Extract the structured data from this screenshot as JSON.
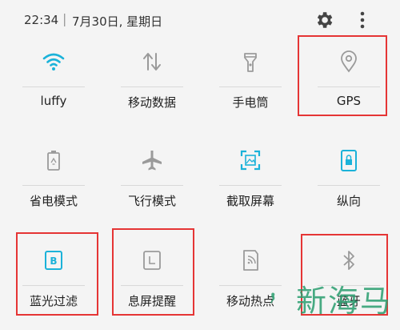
{
  "status": {
    "time": "22:34",
    "separator": "|",
    "date": "7月30日, 星期日"
  },
  "tiles": [
    {
      "label": "luffy",
      "icon": "wifi-icon",
      "active": true
    },
    {
      "label": "移动数据",
      "icon": "mobile-data-icon",
      "active": false
    },
    {
      "label": "手电筒",
      "icon": "flashlight-icon",
      "active": false
    },
    {
      "label": "GPS",
      "icon": "location-icon",
      "active": false
    },
    {
      "label": "省电模式",
      "icon": "power-saving-icon",
      "active": false
    },
    {
      "label": "飞行模式",
      "icon": "airplane-icon",
      "active": false
    },
    {
      "label": "截取屏幕",
      "icon": "screenshot-icon",
      "active": true
    },
    {
      "label": "纵向",
      "icon": "portrait-lock-icon",
      "active": true
    },
    {
      "label": "蓝光过滤",
      "icon": "blue-light-filter-icon",
      "active": true
    },
    {
      "label": "息屏提醒",
      "icon": "always-on-display-icon",
      "active": false
    },
    {
      "label": "移动热点",
      "icon": "hotspot-icon",
      "active": false
    },
    {
      "label": "蓝牙",
      "icon": "bluetooth-icon",
      "active": false
    }
  ],
  "colors": {
    "accent": "#1bb2d9",
    "inactive": "#9a9a9a",
    "highlight": "#e53535"
  },
  "watermark": {
    "text": "新海马"
  }
}
